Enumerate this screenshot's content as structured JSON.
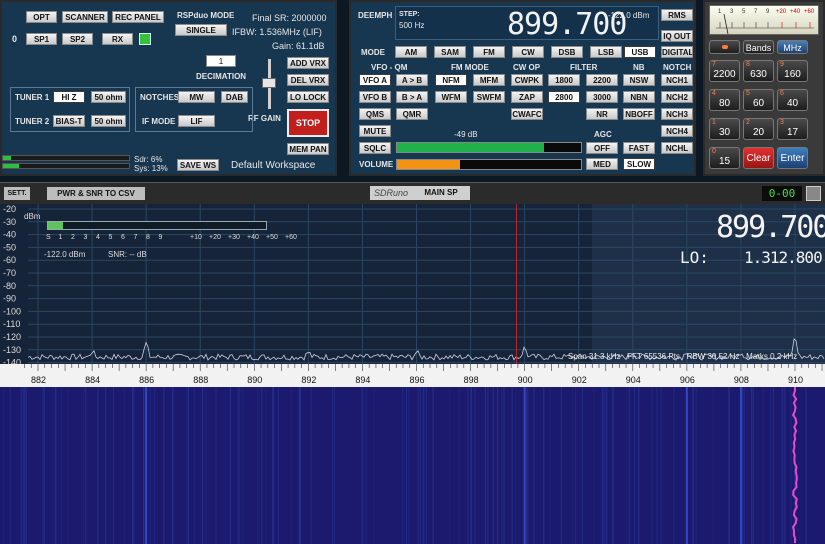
{
  "rsp_panel": {
    "opt": "OPT",
    "scanner": "SCANNER",
    "rec_panel": "REC PANEL",
    "mode_title": "RSPduo MODE",
    "single": "SINGLE",
    "zero": "0",
    "sp1": "SP1",
    "sp2": "SP2",
    "rx": "RX",
    "final_sr": "Final SR: 2000000",
    "ifbw": "IFBW: 1.536MHz (LIF)",
    "gain": "Gain: 61.1dB",
    "decimation_value": "1",
    "decimation_label": "DECIMATION",
    "add_vrx": "ADD VRX",
    "del_vrx": "DEL VRX",
    "lo_lock": "LO LOCK",
    "stop": "STOP",
    "rf_gain": "RF GAIN",
    "mem_pan": "MEM PAN",
    "tuner1": "TUNER 1",
    "hiz": "HI Z",
    "ohm1": "50 ohm",
    "tuner2": "TUNER 2",
    "biast": "BIAS-T",
    "ohm2": "50 ohm",
    "notches": "NOTCHES",
    "mw": "MW",
    "dab": "DAB",
    "if_mode": "IF MODE",
    "lif": "LIF",
    "sdr_load": "Sdr: 6%",
    "sys_load": "Sys: 13%",
    "sdr_level": 0.06,
    "sys_level": 0.13,
    "save_ws": "SAVE WS",
    "workspace": "Default Workspace"
  },
  "rx_panel": {
    "deemph": "DEEMPH",
    "step_label": "STEP:",
    "step_value": "500 Hz",
    "frequency": "899.700",
    "level": "-122.0 dBm",
    "rms": "RMS",
    "iq_out": "IQ OUT",
    "digital": "DIGITAL",
    "mode_label": "MODE",
    "modes": [
      "AM",
      "SAM",
      "FM",
      "CW",
      "DSB",
      "LSB",
      "USB"
    ],
    "selected_mode": "USB",
    "vfo_qm": "VFO - QM",
    "fm_mode": "FM MODE",
    "cw_op": "CW OP",
    "filter": "FILTER",
    "nb": "NB",
    "notch": "NOTCH",
    "vfo_a": "VFO A",
    "a_to_b": "A > B",
    "nfm": "NFM",
    "mfm": "MFM",
    "cwpk": "CWPK",
    "f1800": "1800",
    "f2200": "2200",
    "nsw": "NSW",
    "nch1": "NCH1",
    "vfo_b": "VFO B",
    "b_to_a": "B > A",
    "wfm": "WFM",
    "swfm": "SWFM",
    "zap": "ZAP",
    "f2800": "2800",
    "f3000": "3000",
    "nbn": "NBN",
    "nch2": "NCH2",
    "qms": "QMS",
    "qmr": "QMR",
    "cwafc": "CWAFC",
    "nr": "NR",
    "nboff": "NBOFF",
    "nch3": "NCH3",
    "mute": "MUTE",
    "sig_db": "-49 dB",
    "agc": "AGC",
    "nch4": "NCH4",
    "sqlc": "SQLC",
    "off": "OFF",
    "fast": "FAST",
    "nchl": "NCHL",
    "volume": "VOLUME",
    "med": "MED",
    "slow": "SLOW",
    "sql_level": 0.8,
    "volume_level": 0.34
  },
  "keypad": {
    "smeter": [
      "1",
      "3",
      "5",
      "7",
      "9",
      "+20",
      "+40",
      "+60"
    ],
    "bands": "Bands",
    "mhz": "MHz",
    "keys": [
      {
        "n": "7",
        "v": "2200"
      },
      {
        "n": "8",
        "v": "630"
      },
      {
        "n": "9",
        "v": "160"
      },
      {
        "n": "4",
        "v": "80"
      },
      {
        "n": "5",
        "v": "60"
      },
      {
        "n": "6",
        "v": "40"
      },
      {
        "n": "1",
        "v": "30"
      },
      {
        "n": "2",
        "v": "20"
      },
      {
        "n": "3",
        "v": "17"
      }
    ],
    "zero_n": "0",
    "zero_v": "15",
    "clear": "Clear",
    "enter": "Enter"
  },
  "main_sp": {
    "sett": "SETT.",
    "pwr_snr": "PWR & SNR TO CSV",
    "logo": "SDRuno",
    "title": "MAIN SP",
    "counter": "0-00",
    "dbm_unit": "dBm",
    "level_dbm": "-122.0 dBm",
    "snr": "SNR: -- dB",
    "smeter_ticks": [
      "S",
      "1",
      "2",
      "3",
      "4",
      "5",
      "6",
      "7",
      "8",
      "9",
      "+10",
      "+20",
      "+30",
      "+40",
      "+50",
      "+60"
    ],
    "big_freq": "899.700",
    "lo_label": "LO:",
    "lo_freq": "1.312.800",
    "status": "Span 31.3 kHz   FFT 65536 Pts   RBW 30.52 Hz   Marks 0.2 kHz",
    "y_ticks": [
      "-20",
      "-30",
      "-40",
      "-50",
      "-60",
      "-70",
      "-80",
      "-90",
      "-100",
      "-110",
      "-120",
      "-130",
      "-140"
    ],
    "x_ticks": [
      "882",
      "884",
      "886",
      "888",
      "890",
      "892",
      "894",
      "896",
      "898",
      "900",
      "902",
      "904",
      "906",
      "908",
      "910"
    ]
  },
  "colors": {
    "panel_bg": "#17364f",
    "spectrum_bg": "#152438",
    "waterfall_bg": "#1b1a6e",
    "sql_bar": "#1fb24a",
    "volume_bar": "#f39313",
    "stop": "#c21f1f"
  }
}
